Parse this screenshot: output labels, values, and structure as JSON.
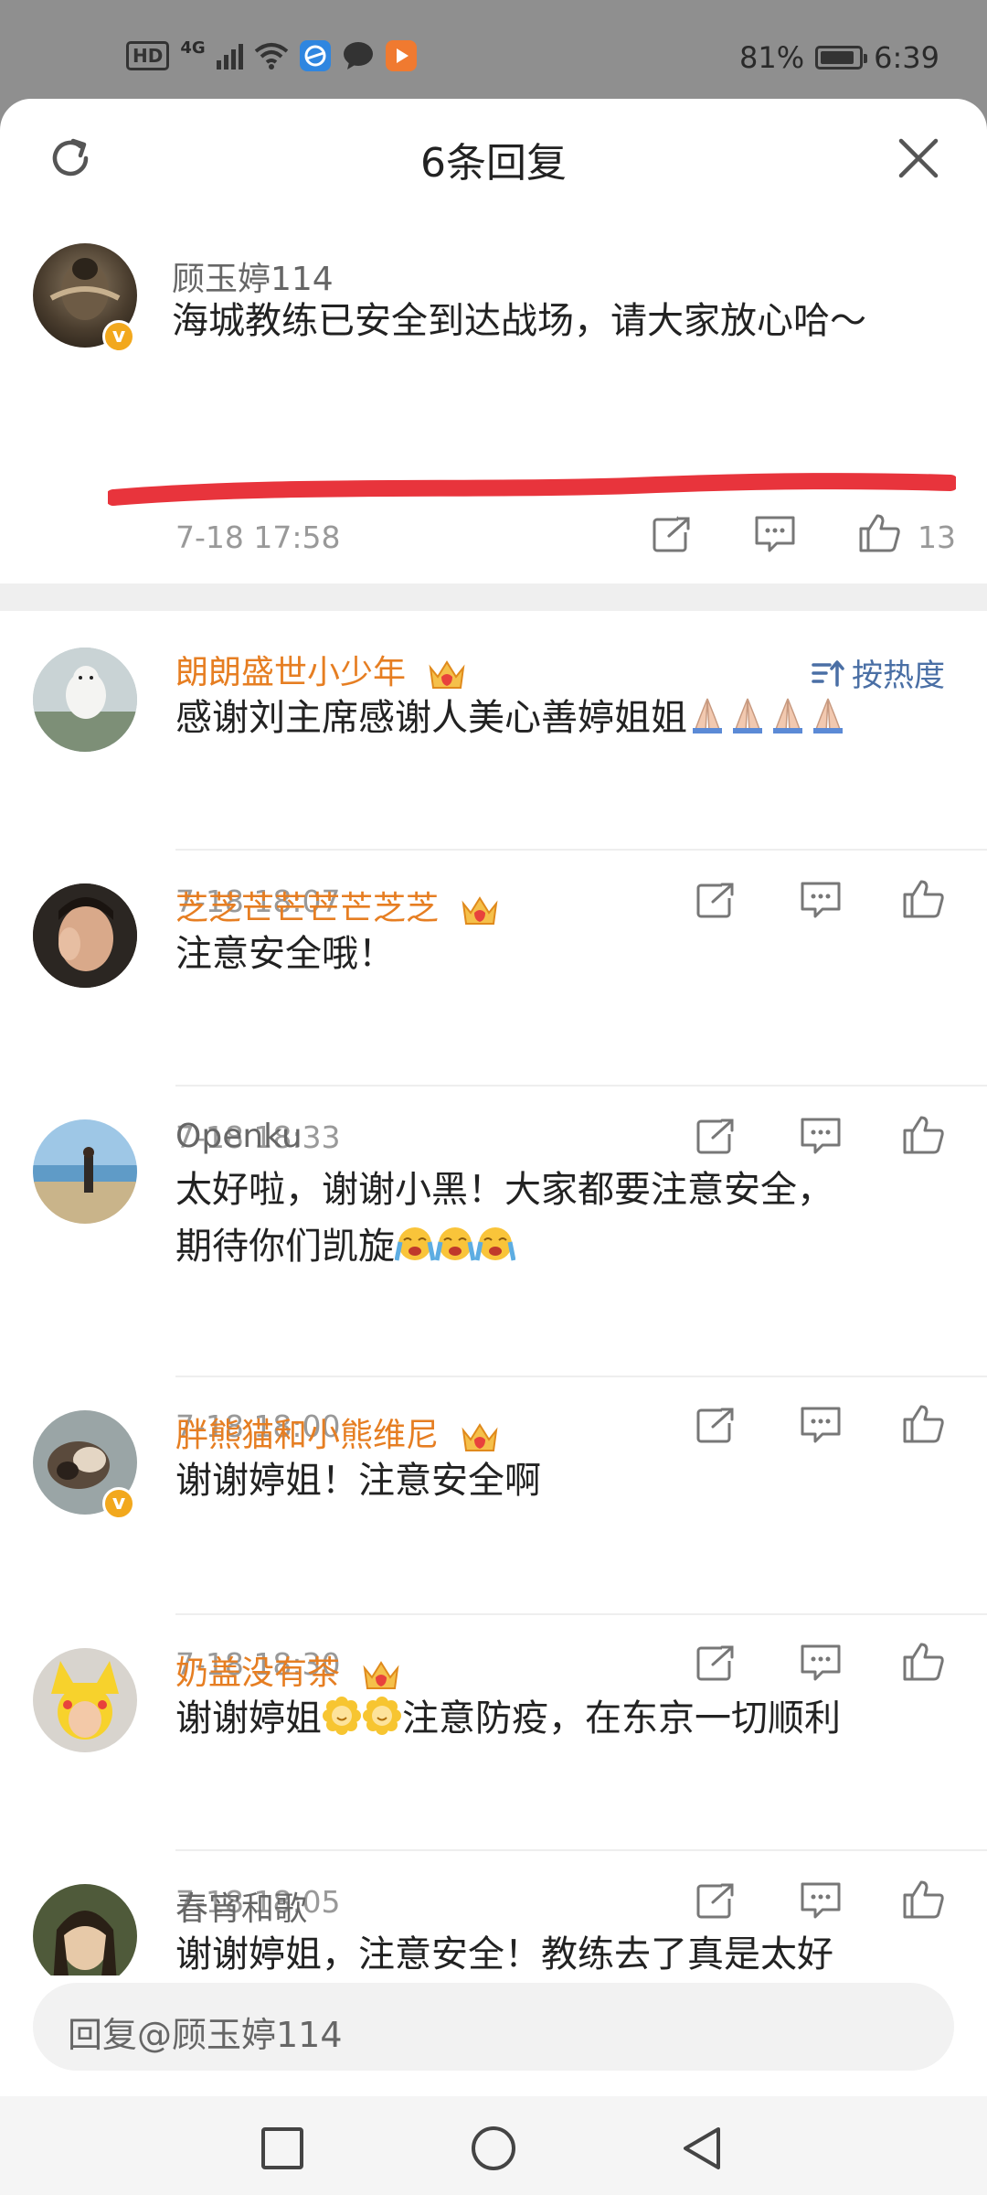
{
  "status_bar": {
    "hd": "HD",
    "network": "4G",
    "battery_pct": "81%",
    "time": "6:39"
  },
  "header": {
    "title": "6条回复"
  },
  "original": {
    "username": "顾玉婷114",
    "text": "海城教练已安全到达战场，请大家放心哈～",
    "time": "7-18 17:58",
    "likes": "13",
    "verified_badge": "v"
  },
  "sort": {
    "label": "按热度"
  },
  "comments": [
    {
      "username": "朗朗盛世小少年",
      "text": "感谢刘主席感谢人美心善婷姐姐",
      "time": "7-18 18:07",
      "vip": true
    },
    {
      "username": "芝芝芒芒芒芒芝芝",
      "text": "注意安全哦！",
      "time": "7-18 18:33",
      "vip": true
    },
    {
      "username": "Openku",
      "text_line1": "太好啦，谢谢小黑！大家都要注意安全，",
      "text_line2": "期待你们凯旋",
      "time": "7-18 18:00",
      "vip": false
    },
    {
      "username": "胖熊猫和小熊维尼",
      "text": "谢谢婷姐！注意安全啊",
      "time": "7-18 18:30",
      "vip": true,
      "verified_badge": "v"
    },
    {
      "username": "奶盖没有茶",
      "text_pre": "谢谢婷姐",
      "text_post": "注意防疫，在东京一切顺利",
      "time": "7-18 18:05",
      "vip": true
    },
    {
      "username": "春宵和歌",
      "text": "谢谢婷姐，注意安全！教练去了真是太好",
      "vip": false
    }
  ],
  "reply": {
    "placeholder": "回复@顾玉婷114"
  },
  "icons": {
    "refresh": "refresh-icon",
    "close": "close-icon",
    "share": "share-icon",
    "comment": "comment-icon",
    "like": "thumbs-up-icon",
    "crown": "vip-crown-icon"
  },
  "colors": {
    "accent_orange": "#e67e22",
    "link_blue": "#4a6fa5",
    "annotation_red": "#e8343c"
  }
}
